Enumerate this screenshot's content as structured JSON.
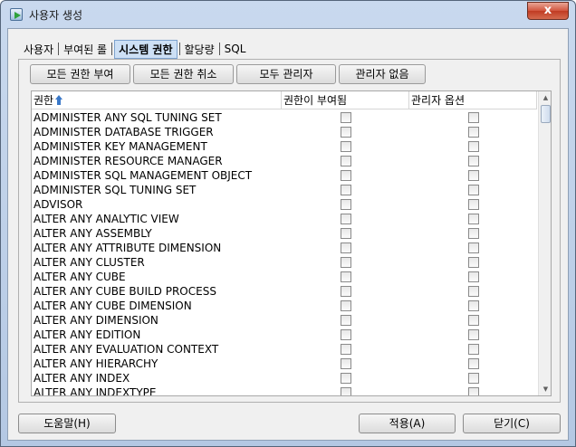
{
  "window": {
    "title": "사용자 생성",
    "close_glyph": "x"
  },
  "tabs": [
    {
      "label": "사용자",
      "active": false
    },
    {
      "label": "부여된 롤",
      "active": false
    },
    {
      "label": "시스템 권한",
      "active": true
    },
    {
      "label": "할당량",
      "active": false
    },
    {
      "label": "SQL",
      "active": false
    }
  ],
  "toolbar": {
    "grant_all": "모든 권한 부여",
    "revoke_all": "모든 권한 취소",
    "all_admin": "모두 관리자",
    "no_admin": "관리자 없음"
  },
  "grid": {
    "columns": [
      "권한",
      "권한이 부여됨",
      "관리자 옵션"
    ],
    "rows": [
      "ADMINISTER ANY SQL TUNING SET",
      "ADMINISTER DATABASE TRIGGER",
      "ADMINISTER KEY MANAGEMENT",
      "ADMINISTER RESOURCE MANAGER",
      "ADMINISTER SQL MANAGEMENT OBJECT",
      "ADMINISTER SQL TUNING SET",
      "ADVISOR",
      "ALTER ANY ANALYTIC VIEW",
      "ALTER ANY ASSEMBLY",
      "ALTER ANY ATTRIBUTE DIMENSION",
      "ALTER ANY CLUSTER",
      "ALTER ANY CUBE",
      "ALTER ANY CUBE BUILD PROCESS",
      "ALTER ANY CUBE DIMENSION",
      "ALTER ANY DIMENSION",
      "ALTER ANY EDITION",
      "ALTER ANY EVALUATION CONTEXT",
      "ALTER ANY HIERARCHY",
      "ALTER ANY INDEX",
      "ALTER ANY INDEXTYPE"
    ]
  },
  "footer": {
    "help": "도움말(H)",
    "apply": "적용(A)",
    "close": "닫기(C)"
  }
}
